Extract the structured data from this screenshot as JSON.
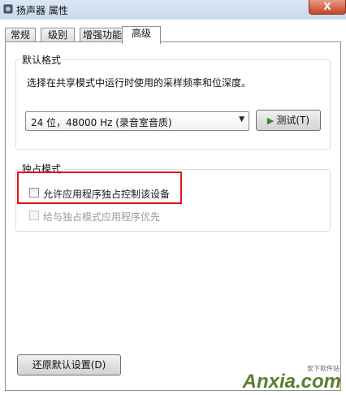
{
  "window": {
    "title": "扬声器 属性",
    "close_label": "X",
    "app_icon": "speaker-icon"
  },
  "tabs": [
    {
      "label": "常规",
      "active": false
    },
    {
      "label": "级别",
      "active": false
    },
    {
      "label": "增强功能",
      "active": false
    },
    {
      "label": "高级",
      "active": true
    }
  ],
  "default_format": {
    "group_label": "默认格式",
    "description": "选择在共享模式中运行时使用的采样频率和位深度。",
    "selected_format": "24 位，48000 Hz (录音室音质)",
    "test_button_label": "测试(T)",
    "test_icon": "play-icon"
  },
  "exclusive_mode": {
    "group_label": "独占模式",
    "allow_exclusive_label": "允许应用程序独占控制该设备",
    "allow_exclusive_checked": false,
    "priority_label": "给与独占模式应用程序优先",
    "priority_checked": false,
    "priority_enabled": false
  },
  "footer": {
    "restore_defaults_label": "还原默认设置(D)"
  },
  "watermark": {
    "main_text": "Anxia.com",
    "small_text": "安下软件站"
  },
  "colors": {
    "highlight_box": "#e0141a",
    "play_icon": "#2a8f1f"
  }
}
